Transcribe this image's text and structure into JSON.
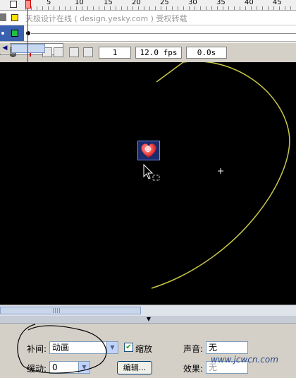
{
  "timeline": {
    "ruler_numbers": [
      "5",
      "10",
      "15",
      "20",
      "25",
      "30",
      "35",
      "40",
      "45"
    ],
    "layer1_text": "天极设计在线 ( design.yesky.com ) 受权转载",
    "status": {
      "frame": "1",
      "fps": "12.0 fps",
      "time": "0.0s"
    }
  },
  "stage": {
    "background": "#000000",
    "path_color": "#c8c84a"
  },
  "properties": {
    "tween_label": "补间:",
    "tween_value": "动画",
    "scale_label": "缩放",
    "scale_checked": true,
    "ease_label": "缓动:",
    "ease_value": "0",
    "edit_label": "编辑...",
    "sound_label": "声音:",
    "sound_value": "无",
    "effect_label": "效果:",
    "effect_value": "无"
  },
  "watermark": {
    "text": "www.jcwcn.com"
  }
}
